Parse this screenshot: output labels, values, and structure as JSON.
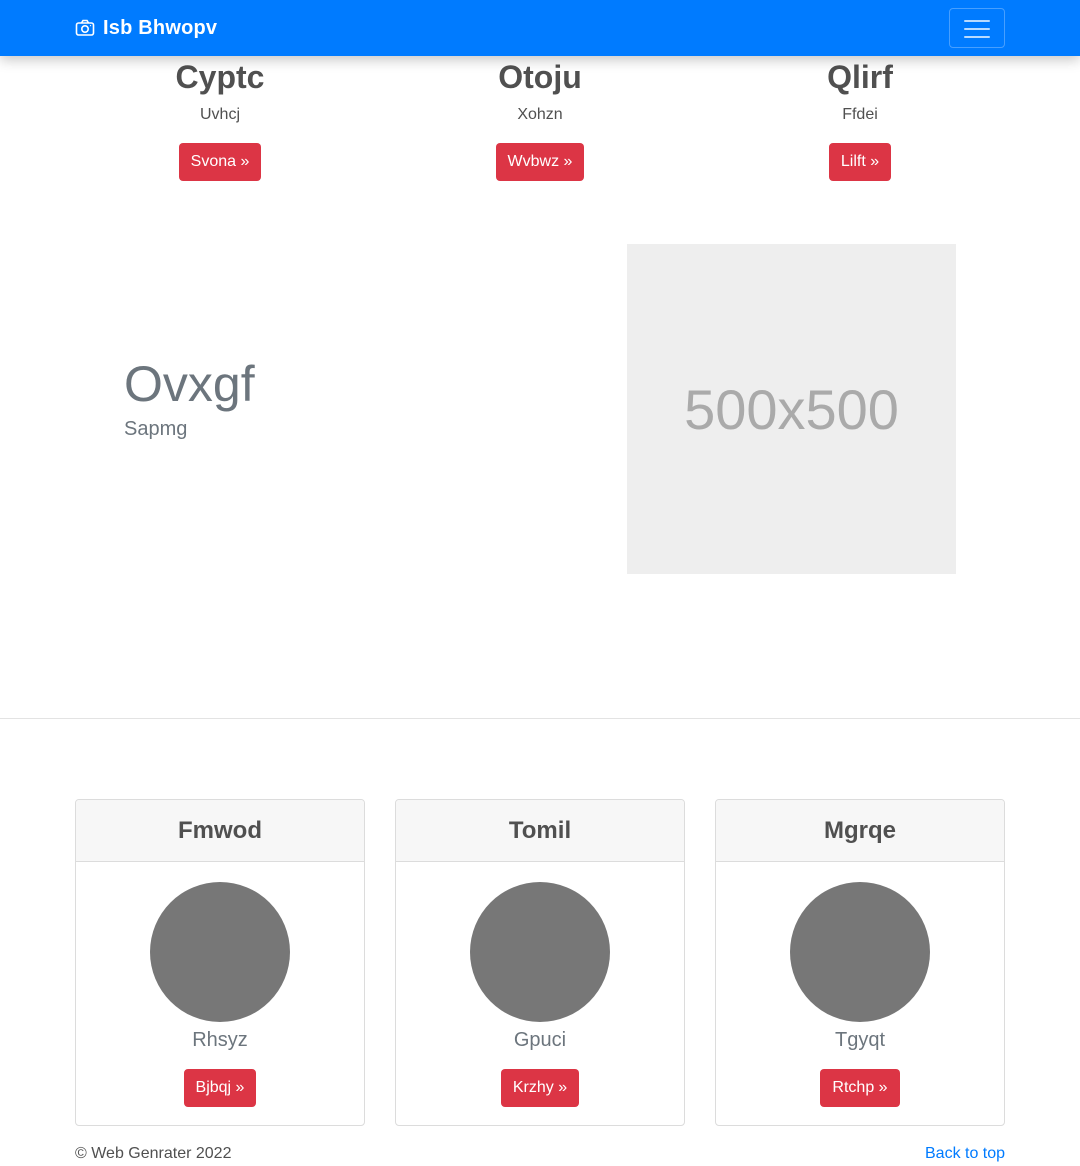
{
  "navbar": {
    "brand_icon": "camera-icon",
    "brand_text": "Isb Bhwopv",
    "toggler_icon": "hamburger-icon"
  },
  "features": [
    {
      "title": "Cyptc",
      "text": "Uvhcj",
      "button": "Svona »"
    },
    {
      "title": "Otoju",
      "text": "Xohzn",
      "button": "Wvbwz »"
    },
    {
      "title": "Qlirf",
      "text": "Ffdei",
      "button": "Lilft »"
    }
  ],
  "featurette": {
    "title": "Ovxgf",
    "subtitle": "Sapmg",
    "image_label": "500x500"
  },
  "cards": [
    {
      "header": "Fmwod",
      "name": "Rhsyz",
      "button": "Bjbqj »"
    },
    {
      "header": "Tomil",
      "name": "Gpuci",
      "button": "Krzhy »"
    },
    {
      "header": "Mgrqe",
      "name": "Tgyqt",
      "button": "Rtchp »"
    }
  ],
  "footer": {
    "copyright": "© Web Genrater 2022",
    "back_to_top": "Back to top"
  },
  "colors": {
    "navbar": "#007bff",
    "button": "#dc3545",
    "avatar": "#777777",
    "link": "#007bff"
  }
}
